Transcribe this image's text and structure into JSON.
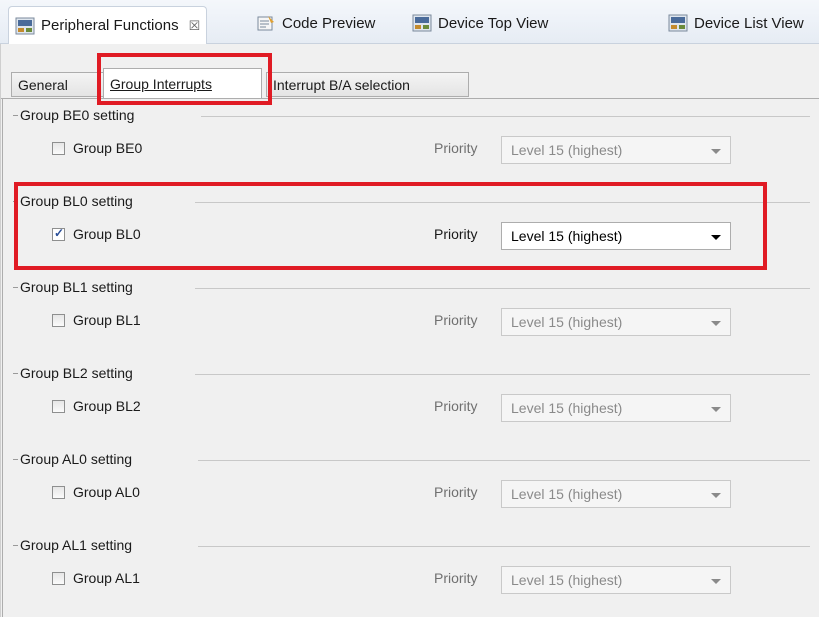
{
  "editor_tabs": [
    {
      "label": "Peripheral Functions",
      "close": "☒"
    },
    {
      "label": "Code Preview"
    },
    {
      "label": "Device Top View"
    },
    {
      "label": "Device List View"
    }
  ],
  "sub_tabs": [
    {
      "label": "General"
    },
    {
      "label": "Group Interrupts"
    },
    {
      "label": "Interrupt B/A selection"
    }
  ],
  "priority_label": "Priority",
  "groups": [
    {
      "legend": "Group BE0 setting",
      "checkbox": "Group BE0",
      "checked": false,
      "priority": "Level 15 (highest)"
    },
    {
      "legend": "Group BL0 setting",
      "checkbox": "Group BL0",
      "checked": true,
      "priority": "Level 15 (highest)"
    },
    {
      "legend": "Group BL1 setting",
      "checkbox": "Group BL1",
      "checked": false,
      "priority": "Level 15 (highest)"
    },
    {
      "legend": "Group BL2 setting",
      "checkbox": "Group BL2",
      "checked": false,
      "priority": "Level 15 (highest)"
    },
    {
      "legend": "Group AL0 setting",
      "checkbox": "Group AL0",
      "checked": false,
      "priority": "Level 15 (highest)"
    },
    {
      "legend": "Group AL1 setting",
      "checkbox": "Group AL1",
      "checked": false,
      "priority": "Level 15 (highest)"
    }
  ],
  "highlight_color": "#e01b24"
}
